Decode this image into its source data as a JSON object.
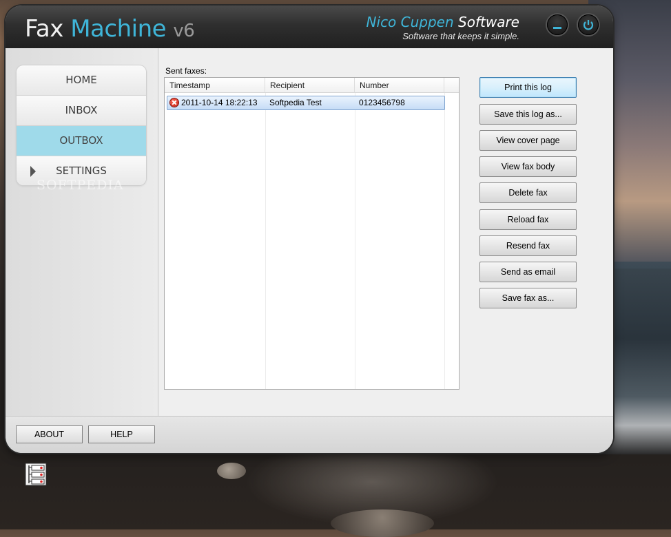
{
  "window": {
    "title_part1": "Fax",
    "title_part2": "Machine",
    "title_version": "v6",
    "brand_name_part1": "Nico Cuppen",
    "brand_name_part2": "Software",
    "brand_tagline": "Software that keeps it simple."
  },
  "nav": {
    "items": [
      {
        "label": "HOME"
      },
      {
        "label": "INBOX"
      },
      {
        "label": "OUTBOX"
      },
      {
        "label": "SETTINGS"
      }
    ],
    "active": "OUTBOX",
    "watermark": "SOFTPEDIA"
  },
  "main": {
    "list_label": "Sent faxes:",
    "columns": [
      "Timestamp",
      "Recipient",
      "Number"
    ],
    "rows": [
      {
        "timestamp": "2011-10-14 18:22:13",
        "recipient": "Softpedia Test",
        "number": "0123456798",
        "status": "error"
      }
    ]
  },
  "actions": [
    {
      "label": "Print this log"
    },
    {
      "label": "Save this log as..."
    },
    {
      "label": "View cover page"
    },
    {
      "label": "View fax body"
    },
    {
      "label": "Delete fax"
    },
    {
      "label": "Reload fax"
    },
    {
      "label": "Resend fax"
    },
    {
      "label": "Send as email"
    },
    {
      "label": "Save fax as..."
    }
  ],
  "footer": {
    "about_label": "ABOUT",
    "help_label": "HELP"
  },
  "colors": {
    "accent": "#3fb5d8",
    "active_nav": "#9fdaea",
    "titlebar": "#2f2f2f"
  },
  "icons": [
    "minimize-icon",
    "power-icon",
    "error-icon",
    "tray-icon"
  ]
}
